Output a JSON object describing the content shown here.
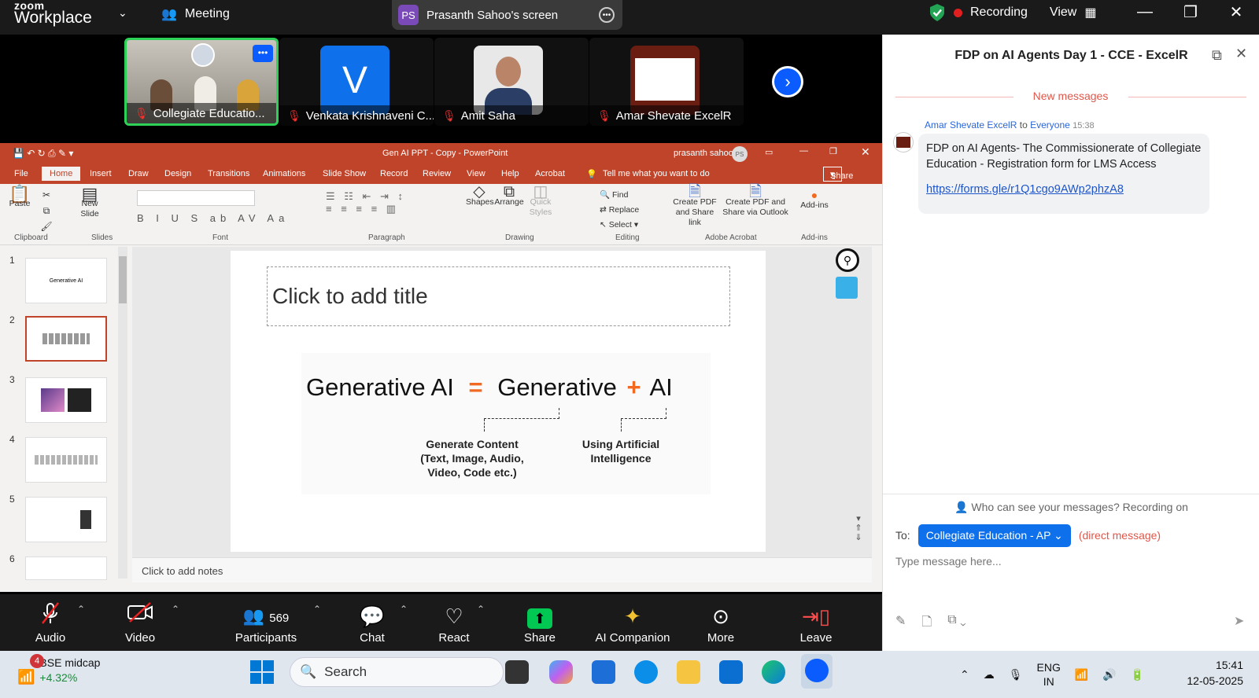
{
  "topbar": {
    "logo_small": "zoom",
    "logo_big": "Workplace",
    "meeting_label": "Meeting",
    "share_initials": "PS",
    "share_label": "Prasanth Sahoo's screen",
    "recording_label": "Recording",
    "view_label": "View"
  },
  "participants": [
    {
      "name": "Collegiate Educatio..."
    },
    {
      "name": "Venkata Krishnaveni C...",
      "avatar_letter": "V"
    },
    {
      "name": "Amit Saha"
    },
    {
      "name": "Amar Shevate ExcelR"
    }
  ],
  "ppt": {
    "window_title": "Gen AI PPT - Copy  -  PowerPoint",
    "user": "prasanth sahoo",
    "user_initials": "PS",
    "tabs": [
      "File",
      "Home",
      "Insert",
      "Draw",
      "Design",
      "Transitions",
      "Animations",
      "Slide Show",
      "Record",
      "Review",
      "View",
      "Help",
      "Acrobat"
    ],
    "tell_me": "Tell me what you want to do",
    "share": "Share",
    "ribbon": {
      "paste": "Paste",
      "new_slide": "New Slide",
      "clipboard": "Clipboard",
      "slides": "Slides",
      "font": "Font",
      "paragraph": "Paragraph",
      "shapes": "Shapes",
      "arrange": "Arrange",
      "quick_styles": "Quick Styles",
      "drawing": "Drawing",
      "find": "Find",
      "replace": "Replace",
      "select": "Select",
      "editing": "Editing",
      "create_pdf": "Create PDF and Share link",
      "create_pdf_outlook": "Create PDF and Share via Outlook",
      "adobe_acrobat": "Adobe Acrobat",
      "addins": "Add-ins",
      "addins_group": "Add-ins"
    },
    "thumbnails": [
      "1",
      "2",
      "3",
      "4",
      "5",
      "6"
    ],
    "thumb1_text": "Generative AI",
    "title_placeholder": "Click to add title",
    "slide_content": {
      "word1": "Generative AI",
      "equals": "=",
      "word2": "Generative",
      "plus": "+",
      "word3": "AI",
      "note1": "Generate Content (Text, Image, Audio, Video, Code etc.)",
      "note2": "Using Artificial Intelligence"
    },
    "notes_placeholder": "Click to add notes"
  },
  "toolbar": {
    "audio": "Audio",
    "video": "Video",
    "participants": "Participants",
    "participant_count": "569",
    "chat": "Chat",
    "react": "React",
    "share": "Share",
    "ai_companion": "AI Companion",
    "more": "More",
    "leave": "Leave"
  },
  "chat": {
    "title": "FDP on AI Agents Day 1 - CCE - ExcelR",
    "new_messages": "New messages",
    "message": {
      "sender": "Amar Shevate ExcelR",
      "to_word": "to",
      "recipient": "Everyone",
      "time": "15:38",
      "text": "FDP on AI Agents- The Commissionerate of Collegiate Education - Registration form for LMS Access",
      "link": "https://forms.gle/r1Q1cgo9AWp2phzA8"
    },
    "privacy": "Who can see your messages? Recording on",
    "to_label": "To:",
    "to_value": "Collegiate Education - AP",
    "direct": "(direct message)",
    "input_placeholder": "Type message here..."
  },
  "taskbar": {
    "notif_count": "4",
    "stock_name": "BSE midcap",
    "stock_change": "+4.32%",
    "search": "Search",
    "lang1": "ENG",
    "lang2": "IN",
    "time": "15:41",
    "date": "12-05-2025"
  },
  "colors": {
    "ppt_red": "#c0442a",
    "zoom_blue": "#0e71eb",
    "accent_orange": "#f26a21",
    "share_green": "#00c853"
  }
}
